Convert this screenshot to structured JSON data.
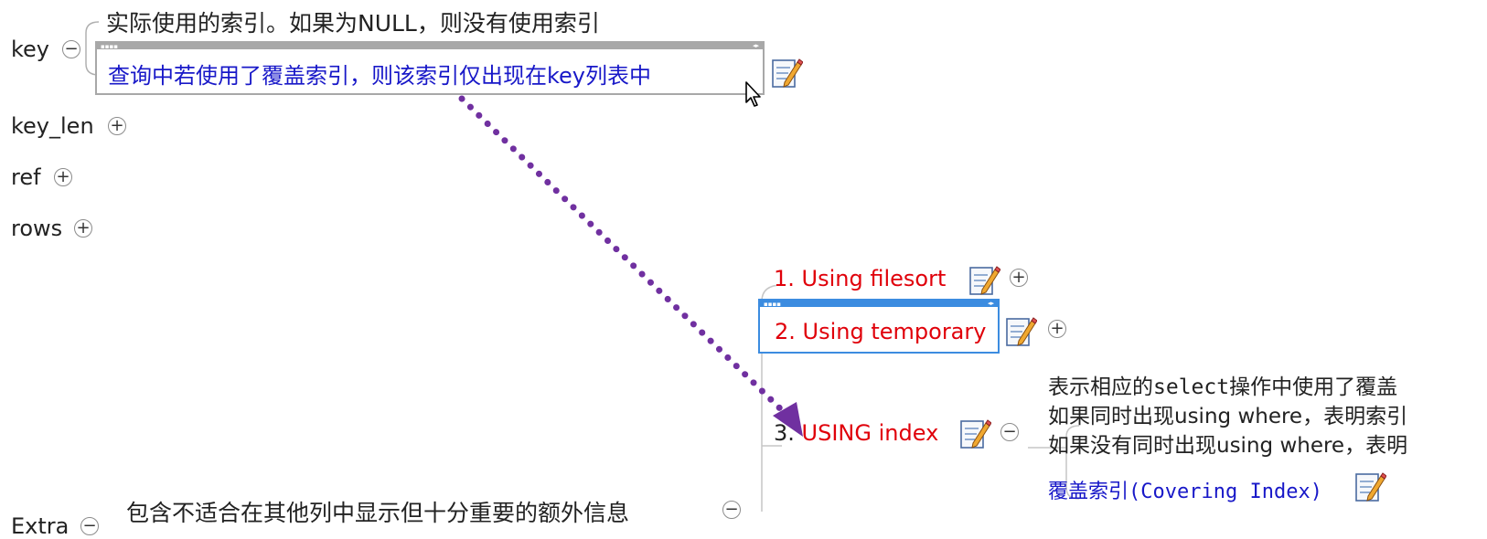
{
  "left_nodes": {
    "key": "key",
    "key_len": "key_len",
    "ref": "ref",
    "rows": "rows",
    "extra_partial": "Extra"
  },
  "key_note": "实际使用的索引。如果为NULL，则没有使用索引",
  "key_edit_text": "查询中若使用了覆盖索引，则该索引仅出现在key列表中",
  "extra_note_partial": "包含不适合在其他列中显示但十分重要的额外信息",
  "extra_items": [
    {
      "label": "1. Using filesort"
    },
    {
      "label": "2. Using temporary"
    },
    {
      "num": "3.",
      "label": "USING index"
    }
  ],
  "index_notes": {
    "line1_a": "表示相应的",
    "line1_b": "select",
    "line1_c": "操作中使用了覆盖",
    "line2": "如果同时出现using where，表明索引",
    "line3": "如果没有同时出现using where，表明",
    "covering_a": "覆盖索引",
    "covering_b": "(Covering Index)"
  },
  "toggles": {
    "expanded": "−",
    "collapsed": "+"
  },
  "colors": {
    "accent_red": "#e0000a",
    "note_blue": "#1818c8",
    "arrow_purple": "#7030a0",
    "focus_blue": "#3c8ce0",
    "grey_frame": "#a8a8a8"
  }
}
